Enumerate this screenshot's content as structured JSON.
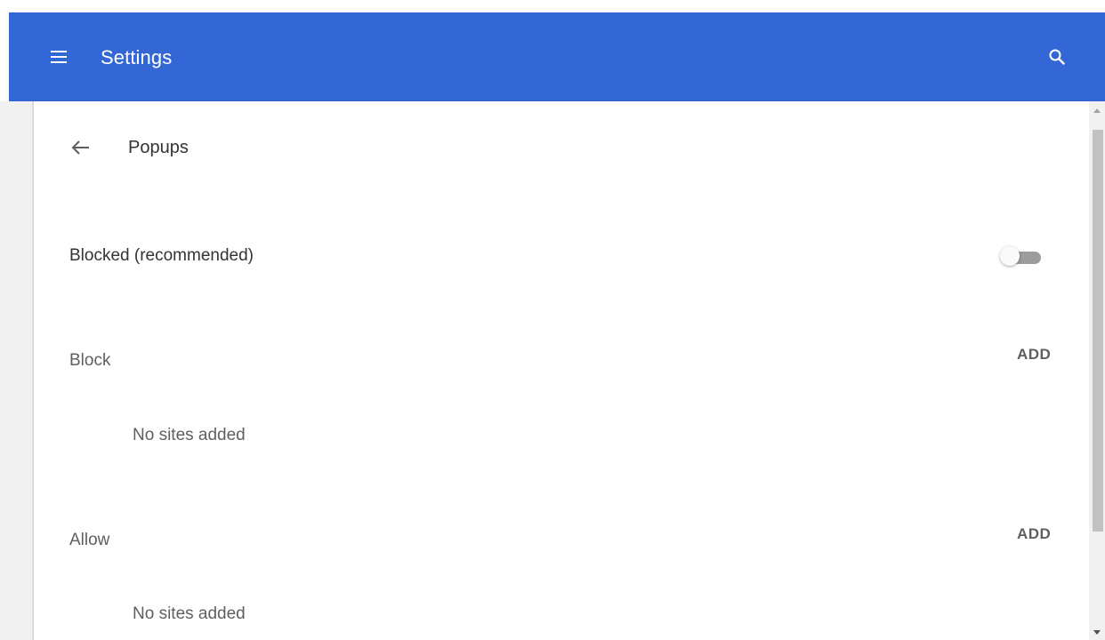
{
  "toolbar": {
    "menu_icon": "menu-icon",
    "title": "Settings",
    "search_icon": "search-icon",
    "background_color": "#3367d6"
  },
  "page": {
    "back_icon": "arrow-back-icon",
    "title": "Popups"
  },
  "setting": {
    "label": "Blocked (recommended)",
    "toggle_on": false
  },
  "sections": [
    {
      "label": "Block",
      "add_label": "ADD",
      "empty_text": "No sites added"
    },
    {
      "label": "Allow",
      "add_label": "ADD",
      "empty_text": "No sites added"
    }
  ]
}
